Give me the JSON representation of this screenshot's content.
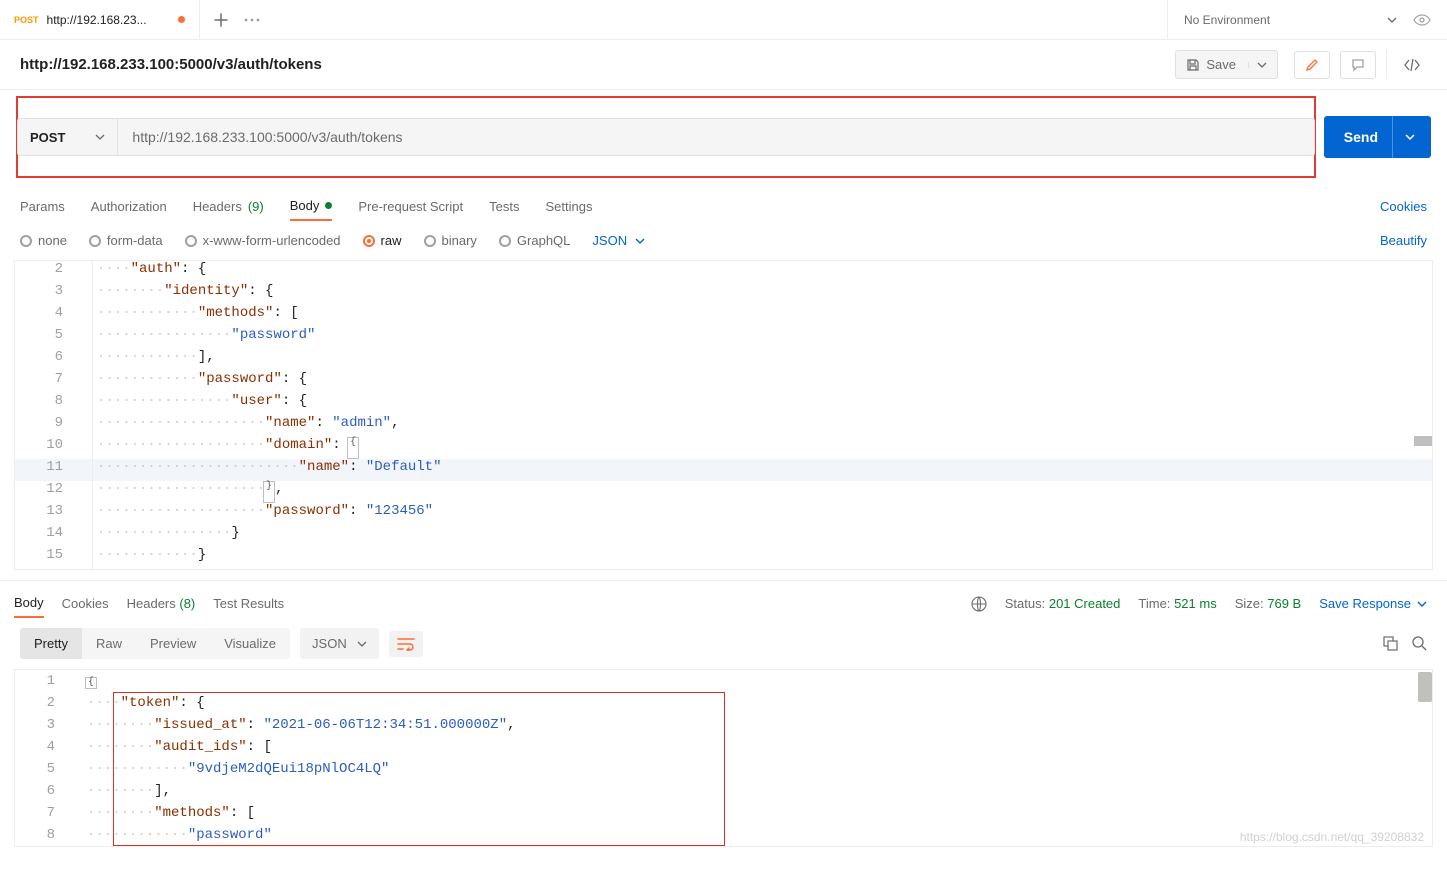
{
  "tab": {
    "method": "POST",
    "title": "http://192.168.23..."
  },
  "env": {
    "label": "No Environment"
  },
  "header": {
    "title": "http://192.168.233.100:5000/v3/auth/tokens",
    "save": "Save"
  },
  "url": {
    "method": "POST",
    "value": "http://192.168.233.100:5000/v3/auth/tokens",
    "send": "Send"
  },
  "reqTabs": {
    "params": "Params",
    "auth": "Authorization",
    "headers": "Headers",
    "hcount": "(9)",
    "body": "Body",
    "pre": "Pre-request Script",
    "tests": "Tests",
    "settings": "Settings",
    "cookies": "Cookies"
  },
  "bodyTypes": {
    "none": "none",
    "form": "form-data",
    "xwww": "x-www-form-urlencoded",
    "raw": "raw",
    "binary": "binary",
    "gql": "GraphQL",
    "fmt": "JSON",
    "beautify": "Beautify"
  },
  "reqCode": {
    "startLine": 2,
    "lines": [
      {
        "n": "2",
        "i": "····",
        "k": "\"auth\"",
        "p": ": {"
      },
      {
        "n": "3",
        "i": "········",
        "k": "\"identity\"",
        "p": ": {"
      },
      {
        "n": "4",
        "i": "············",
        "k": "\"methods\"",
        "p": ": ["
      },
      {
        "n": "5",
        "i": "················",
        "s": "\"password\""
      },
      {
        "n": "6",
        "i": "············",
        "p": "],"
      },
      {
        "n": "7",
        "i": "············",
        "k": "\"password\"",
        "p": ": {"
      },
      {
        "n": "8",
        "i": "················",
        "k": "\"user\"",
        "p": ": {"
      },
      {
        "n": "9",
        "i": "····················",
        "k": "\"name\"",
        "p": ": ",
        "s": "\"admin\"",
        "t": ","
      },
      {
        "n": "10",
        "i": "····················",
        "k": "\"domain\"",
        "p": ": ",
        "fold": "{"
      },
      {
        "n": "11",
        "i": "························",
        "k": "\"name\"",
        "p": ": ",
        "s": "\"Default\"",
        "hl": true
      },
      {
        "n": "12",
        "i": "····················",
        "fold": "}",
        "t": ","
      },
      {
        "n": "13",
        "i": "····················",
        "k": "\"password\"",
        "p": ": ",
        "s": "\"123456\""
      },
      {
        "n": "14",
        "i": "················",
        "p": "}"
      },
      {
        "n": "15",
        "i": "············",
        "p": "}"
      }
    ]
  },
  "respTabs": {
    "body": "Body",
    "cookies": "Cookies",
    "headers": "Headers",
    "hcount": "(8)",
    "results": "Test Results"
  },
  "status": {
    "statusL": "Status:",
    "statusV": "201 Created",
    "timeL": "Time:",
    "timeV": "521 ms",
    "sizeL": "Size:",
    "sizeV": "769 B",
    "save": "Save Response"
  },
  "respTools": {
    "pretty": "Pretty",
    "raw": "Raw",
    "preview": "Preview",
    "visualize": "Visualize",
    "fmt": "JSON"
  },
  "respCode": {
    "lines": [
      {
        "n": "1",
        "i": "",
        "fold": "{"
      },
      {
        "n": "2",
        "i": "····",
        "k": "\"token\"",
        "p": ": {"
      },
      {
        "n": "3",
        "i": "········",
        "k": "\"issued_at\"",
        "p": ": ",
        "s": "\"2021-06-06T12:34:51.000000Z\"",
        "t": ","
      },
      {
        "n": "4",
        "i": "········",
        "k": "\"audit_ids\"",
        "p": ": ["
      },
      {
        "n": "5",
        "i": "············",
        "s": "\"9vdjeM2dQEui18pNlOC4LQ\""
      },
      {
        "n": "6",
        "i": "········",
        "p": "],"
      },
      {
        "n": "7",
        "i": "········",
        "k": "\"methods\"",
        "p": ": ["
      },
      {
        "n": "8",
        "i": "············",
        "s": "\"password\""
      }
    ]
  },
  "watermark": "https://blog.csdn.net/qq_39208832"
}
